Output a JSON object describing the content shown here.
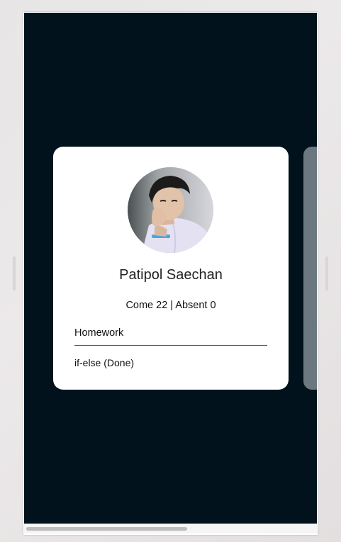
{
  "student": {
    "name": "Patipol Saechan",
    "attendance": "Come 22 | Absent 0"
  },
  "homework": {
    "section_label": "Homework",
    "items": [
      "if-else (Done)"
    ]
  },
  "colors": {
    "background": "#02121c",
    "card": "#ffffff",
    "next_card": "#6b7880"
  },
  "horizontal_scroll_position": 0.0
}
